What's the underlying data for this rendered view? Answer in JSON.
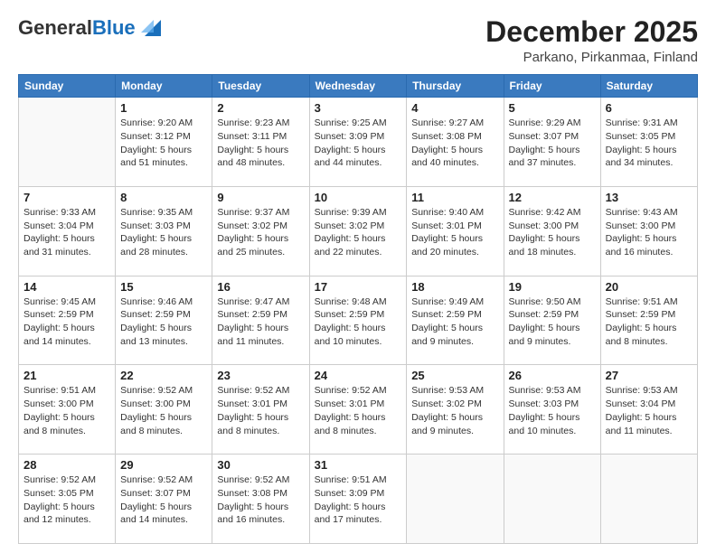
{
  "header": {
    "logo_general": "General",
    "logo_blue": "Blue",
    "month_title": "December 2025",
    "location": "Parkano, Pirkanmaa, Finland"
  },
  "days_of_week": [
    "Sunday",
    "Monday",
    "Tuesday",
    "Wednesday",
    "Thursday",
    "Friday",
    "Saturday"
  ],
  "weeks": [
    [
      {
        "day": "",
        "info": ""
      },
      {
        "day": "1",
        "info": "Sunrise: 9:20 AM\nSunset: 3:12 PM\nDaylight: 5 hours\nand 51 minutes."
      },
      {
        "day": "2",
        "info": "Sunrise: 9:23 AM\nSunset: 3:11 PM\nDaylight: 5 hours\nand 48 minutes."
      },
      {
        "day": "3",
        "info": "Sunrise: 9:25 AM\nSunset: 3:09 PM\nDaylight: 5 hours\nand 44 minutes."
      },
      {
        "day": "4",
        "info": "Sunrise: 9:27 AM\nSunset: 3:08 PM\nDaylight: 5 hours\nand 40 minutes."
      },
      {
        "day": "5",
        "info": "Sunrise: 9:29 AM\nSunset: 3:07 PM\nDaylight: 5 hours\nand 37 minutes."
      },
      {
        "day": "6",
        "info": "Sunrise: 9:31 AM\nSunset: 3:05 PM\nDaylight: 5 hours\nand 34 minutes."
      }
    ],
    [
      {
        "day": "7",
        "info": "Sunrise: 9:33 AM\nSunset: 3:04 PM\nDaylight: 5 hours\nand 31 minutes."
      },
      {
        "day": "8",
        "info": "Sunrise: 9:35 AM\nSunset: 3:03 PM\nDaylight: 5 hours\nand 28 minutes."
      },
      {
        "day": "9",
        "info": "Sunrise: 9:37 AM\nSunset: 3:02 PM\nDaylight: 5 hours\nand 25 minutes."
      },
      {
        "day": "10",
        "info": "Sunrise: 9:39 AM\nSunset: 3:02 PM\nDaylight: 5 hours\nand 22 minutes."
      },
      {
        "day": "11",
        "info": "Sunrise: 9:40 AM\nSunset: 3:01 PM\nDaylight: 5 hours\nand 20 minutes."
      },
      {
        "day": "12",
        "info": "Sunrise: 9:42 AM\nSunset: 3:00 PM\nDaylight: 5 hours\nand 18 minutes."
      },
      {
        "day": "13",
        "info": "Sunrise: 9:43 AM\nSunset: 3:00 PM\nDaylight: 5 hours\nand 16 minutes."
      }
    ],
    [
      {
        "day": "14",
        "info": "Sunrise: 9:45 AM\nSunset: 2:59 PM\nDaylight: 5 hours\nand 14 minutes."
      },
      {
        "day": "15",
        "info": "Sunrise: 9:46 AM\nSunset: 2:59 PM\nDaylight: 5 hours\nand 13 minutes."
      },
      {
        "day": "16",
        "info": "Sunrise: 9:47 AM\nSunset: 2:59 PM\nDaylight: 5 hours\nand 11 minutes."
      },
      {
        "day": "17",
        "info": "Sunrise: 9:48 AM\nSunset: 2:59 PM\nDaylight: 5 hours\nand 10 minutes."
      },
      {
        "day": "18",
        "info": "Sunrise: 9:49 AM\nSunset: 2:59 PM\nDaylight: 5 hours\nand 9 minutes."
      },
      {
        "day": "19",
        "info": "Sunrise: 9:50 AM\nSunset: 2:59 PM\nDaylight: 5 hours\nand 9 minutes."
      },
      {
        "day": "20",
        "info": "Sunrise: 9:51 AM\nSunset: 2:59 PM\nDaylight: 5 hours\nand 8 minutes."
      }
    ],
    [
      {
        "day": "21",
        "info": "Sunrise: 9:51 AM\nSunset: 3:00 PM\nDaylight: 5 hours\nand 8 minutes."
      },
      {
        "day": "22",
        "info": "Sunrise: 9:52 AM\nSunset: 3:00 PM\nDaylight: 5 hours\nand 8 minutes."
      },
      {
        "day": "23",
        "info": "Sunrise: 9:52 AM\nSunset: 3:01 PM\nDaylight: 5 hours\nand 8 minutes."
      },
      {
        "day": "24",
        "info": "Sunrise: 9:52 AM\nSunset: 3:01 PM\nDaylight: 5 hours\nand 8 minutes."
      },
      {
        "day": "25",
        "info": "Sunrise: 9:53 AM\nSunset: 3:02 PM\nDaylight: 5 hours\nand 9 minutes."
      },
      {
        "day": "26",
        "info": "Sunrise: 9:53 AM\nSunset: 3:03 PM\nDaylight: 5 hours\nand 10 minutes."
      },
      {
        "day": "27",
        "info": "Sunrise: 9:53 AM\nSunset: 3:04 PM\nDaylight: 5 hours\nand 11 minutes."
      }
    ],
    [
      {
        "day": "28",
        "info": "Sunrise: 9:52 AM\nSunset: 3:05 PM\nDaylight: 5 hours\nand 12 minutes."
      },
      {
        "day": "29",
        "info": "Sunrise: 9:52 AM\nSunset: 3:07 PM\nDaylight: 5 hours\nand 14 minutes."
      },
      {
        "day": "30",
        "info": "Sunrise: 9:52 AM\nSunset: 3:08 PM\nDaylight: 5 hours\nand 16 minutes."
      },
      {
        "day": "31",
        "info": "Sunrise: 9:51 AM\nSunset: 3:09 PM\nDaylight: 5 hours\nand 17 minutes."
      },
      {
        "day": "",
        "info": ""
      },
      {
        "day": "",
        "info": ""
      },
      {
        "day": "",
        "info": ""
      }
    ]
  ]
}
